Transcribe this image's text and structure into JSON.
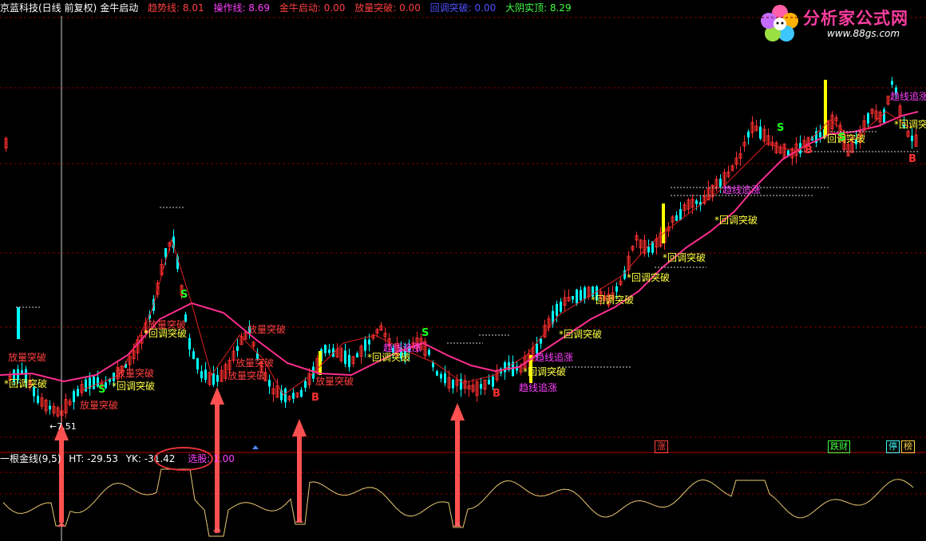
{
  "header": {
    "stock": "京蓝科技(日线 前复权)",
    "indicator": "金牛启动",
    "values": [
      {
        "label": "趋势线: 8.01",
        "color": "#ff4040"
      },
      {
        "label": "操作线: 8.69",
        "color": "#ff40ff"
      },
      {
        "label": "金牛启动: 0.00",
        "color": "#ff4040"
      },
      {
        "label": "放量突破: 0.00",
        "color": "#ff4040"
      },
      {
        "label": "回调突破: 0.00",
        "color": "#5050ff"
      },
      {
        "label": "大阴实顶: 8.29",
        "color": "#40ff40"
      }
    ]
  },
  "logo": {
    "title": "分析家公式网",
    "url": "www.88gs.com"
  },
  "main_chart": {
    "low_label": "←7.51",
    "annotations": [
      {
        "text": "放量突破",
        "color": "#ff4040"
      },
      {
        "text": "*回调突破",
        "color": "#ffff40"
      },
      {
        "text": "趋线追涨",
        "color": "#ff40ff"
      },
      {
        "text": "S",
        "color": "#20ff20"
      },
      {
        "text": "B",
        "color": "#ff3030"
      }
    ],
    "colors": {
      "up": "#ff3030",
      "down": "#00ffff",
      "trend": "#ff2d8f",
      "operate": "#e02020",
      "highlight": "#ffff00"
    }
  },
  "sub_panel": {
    "name": "一根金线(9,5)",
    "ht": "HT: -29.53",
    "yk": "YK: -31.42",
    "pick": "选股: 1.00",
    "tags": [
      {
        "text": "涨",
        "color": "#ff4040"
      },
      {
        "text": "跌财",
        "color": "#40ff40"
      },
      {
        "text": "停",
        "color": "#40ffff"
      },
      {
        "text": "榜",
        "color": "#ffd040"
      }
    ],
    "line_color": "#e8c870"
  }
}
